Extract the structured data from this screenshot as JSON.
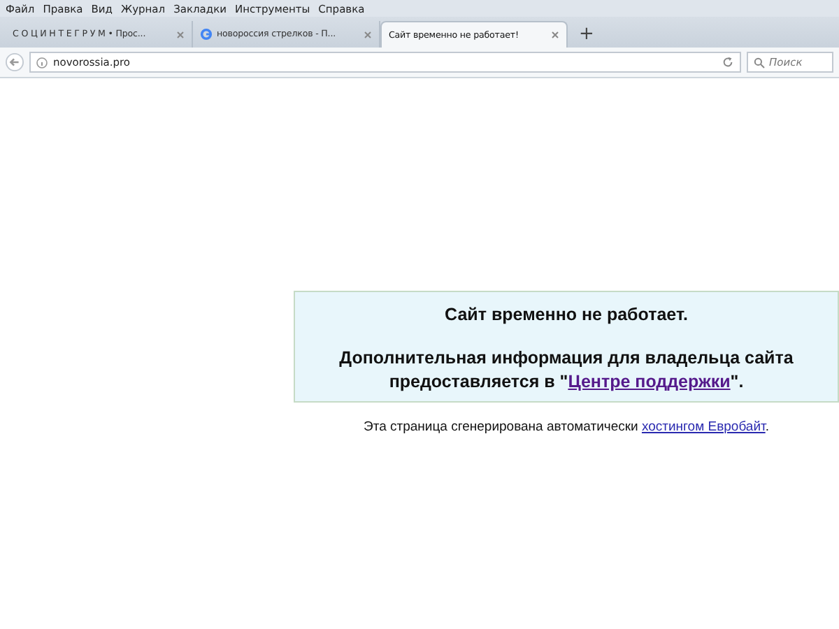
{
  "menu": [
    "Файл",
    "Правка",
    "Вид",
    "Журнал",
    "Закладки",
    "Инструменты",
    "Справка"
  ],
  "tabs": [
    {
      "label": "С О Ц И Н Т Е Г Р У М • Прос...",
      "selected": false,
      "kind": "plain"
    },
    {
      "label": "новороссия стрелков - П...",
      "selected": false,
      "kind": "favicon"
    },
    {
      "label": "Сайт временно не работает!",
      "selected": true,
      "kind": "plain"
    }
  ],
  "new_tab": "+",
  "address": {
    "value": "novorossia.pro"
  },
  "search": {
    "placeholder": "Поиск"
  },
  "notice": {
    "title": "Сайт временно не работает.",
    "message_before": "Дополнительная информация для владельца сайта предоставляется в \"",
    "link": "Центре поддержки",
    "message_after": "\"."
  },
  "footer": {
    "text": "Эта страница сгенерирована автоматически ",
    "link": "хостингом Евробайт",
    "after": "."
  }
}
